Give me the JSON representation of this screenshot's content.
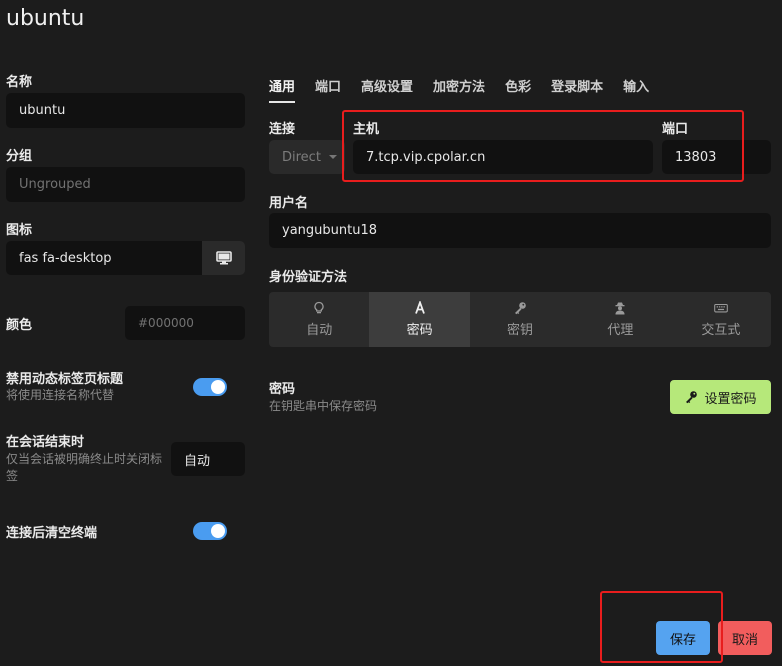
{
  "header": {
    "title": "ubuntu"
  },
  "left": {
    "name_label": "名称",
    "name_value": "ubuntu",
    "group_label": "分组",
    "group_placeholder": "Ungrouped",
    "icon_label": "图标",
    "icon_value": "fas fa-desktop",
    "color_label": "颜色",
    "color_placeholder": "#000000",
    "disable_dynamic_title_label": "禁用动态标签页标题",
    "disable_dynamic_title_sub": "将使用连接名称代替",
    "on_session_end_label": "在会话结束时",
    "on_session_end_sub": "仅当会话被明确终止时关闭标签",
    "on_session_end_value": "自动",
    "clear_terminal_label": "连接后清空终端"
  },
  "tabs": [
    {
      "label": "通用",
      "active": true
    },
    {
      "label": "端口",
      "active": false
    },
    {
      "label": "高级设置",
      "active": false
    },
    {
      "label": "加密方法",
      "active": false
    },
    {
      "label": "色彩",
      "active": false
    },
    {
      "label": "登录脚本",
      "active": false
    },
    {
      "label": "输入",
      "active": false
    }
  ],
  "connection": {
    "label": "连接",
    "type_value": "Direct",
    "host_label": "主机",
    "host_value": "7.tcp.vip.cpolar.cn",
    "port_label": "端口",
    "port_value": "13803"
  },
  "username": {
    "label": "用户名",
    "value": "yangubuntu18"
  },
  "auth": {
    "label": "身份验证方法",
    "options": [
      {
        "label": "自动",
        "icon": "lightbulb-icon",
        "active": false
      },
      {
        "label": "密码",
        "icon": "font-a-icon",
        "active": true
      },
      {
        "label": "密钥",
        "icon": "key-icon",
        "active": false
      },
      {
        "label": "代理",
        "icon": "user-secret-icon",
        "active": false
      },
      {
        "label": "交互式",
        "icon": "keyboard-icon",
        "active": false
      }
    ]
  },
  "password": {
    "label": "密码",
    "sub": "在钥匙串中保存密码",
    "button": "设置密码"
  },
  "footer": {
    "save": "保存",
    "cancel": "取消"
  },
  "colors": {
    "accent": "#4a9cf0",
    "save": "#55a3f0",
    "cancel": "#f25d5d",
    "set_password": "#b6e87a",
    "highlight": "#e81d1d"
  }
}
